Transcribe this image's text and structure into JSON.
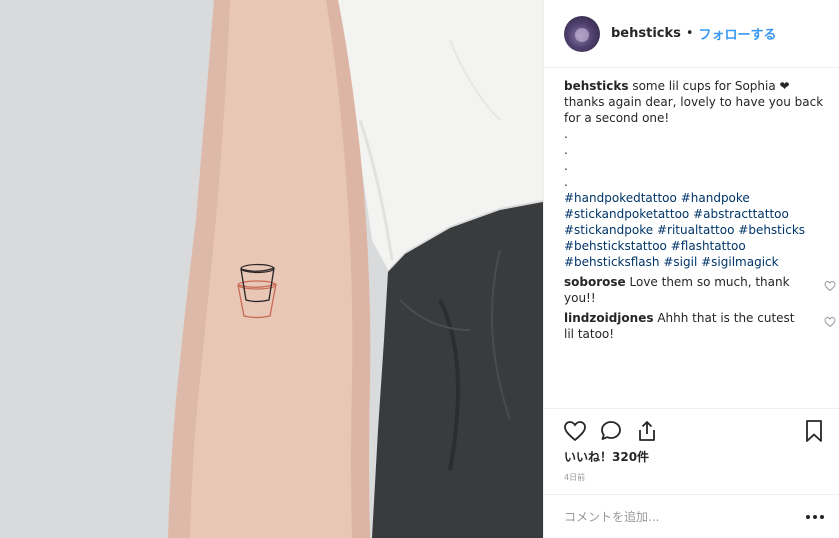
{
  "post": {
    "username": "behsticks",
    "separator": "•",
    "follow_label": "フォローする"
  },
  "caption": {
    "username": "behsticks",
    "text": "some lil cups for Sophia ❤︎ thanks again dear, lovely to have you back for a second one!",
    "dots": [
      ".",
      ".",
      ".",
      "."
    ],
    "hashtags": [
      "#handpokedtattoo",
      "#handpoke",
      "#stickandpoketattoo",
      "#abstracttattoo",
      "#stickandpoke",
      "#ritualtattoo",
      "#behsticks",
      "#behstickstattoo",
      "#flashtattoo",
      "#behsticksflash",
      "#sigil",
      "#sigilmagick"
    ]
  },
  "comments": [
    {
      "username": "soborose",
      "text": "Love them so much, thank you!!"
    },
    {
      "username": "lindzoidjones",
      "text": "Ahhh that is the cutest lil tatoo!"
    }
  ],
  "actions": {
    "likes": "いいね！320件",
    "date": "4日前",
    "comment_placeholder": "コメントを追加...",
    "icons": [
      "heart-icon",
      "comment-icon",
      "share-icon",
      "bookmark-icon"
    ]
  },
  "colors": {
    "link": "#3897f0",
    "hashtag": "#003569",
    "muted": "#999999",
    "text": "#262626"
  }
}
